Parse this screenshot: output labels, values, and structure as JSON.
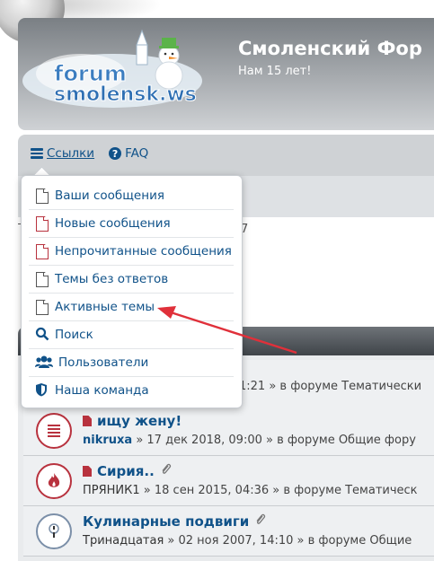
{
  "header": {
    "logo_text_1": "forum",
    "logo_text_2": "smolensk.ws",
    "site_title": "Смоленский Фор",
    "site_description": "Нам 15 лет!"
  },
  "navbar": {
    "links_label": "Ссылки",
    "faq_label": "FAQ"
  },
  "dropdown": {
    "items": [
      {
        "label": "Ваши сообщения",
        "icon": "page-icon"
      },
      {
        "label": "Новые сообщения",
        "icon": "page-red-icon"
      },
      {
        "label": "Непрочитанные сообщения",
        "icon": "page-red-icon"
      },
      {
        "label": "Темы без ответов",
        "icon": "page-icon"
      },
      {
        "label": "Активные темы",
        "icon": "page-icon"
      },
      {
        "label": "Поиск",
        "icon": "search-icon"
      },
      {
        "label": "Пользователи",
        "icon": "users-icon"
      },
      {
        "label": "Наша команда",
        "icon": "shield-icon"
      }
    ]
  },
  "partial_text": "7",
  "topics": [
    {
      "title": "",
      "author": "",
      "meta": "1:21 » в форуме Тематически",
      "icon": "topic-icon"
    },
    {
      "title": "ищу жену!",
      "author": "nikruxa",
      "meta": " » 17 дек 2018, 09:00 » в форуме Общие фору",
      "icon": "hot-topic-icon",
      "has_doc": true
    },
    {
      "title": "Сирия..",
      "author": "ПРЯНИК1",
      "meta": " » 18 сен 2015, 04:36 » в форуме Тематическ",
      "icon": "fire-topic-icon",
      "has_doc": true,
      "has_attachment": true
    },
    {
      "title": "Кулинарные подвиги",
      "author": "Тринадцатая",
      "meta": " » 02 ноя 2007, 14:10 » в форуме Общие",
      "icon": "announce-topic-icon",
      "has_attachment": true
    }
  ],
  "colors": {
    "link": "#105289",
    "accent_red": "#b8323e",
    "arrow": "#e0303a"
  }
}
